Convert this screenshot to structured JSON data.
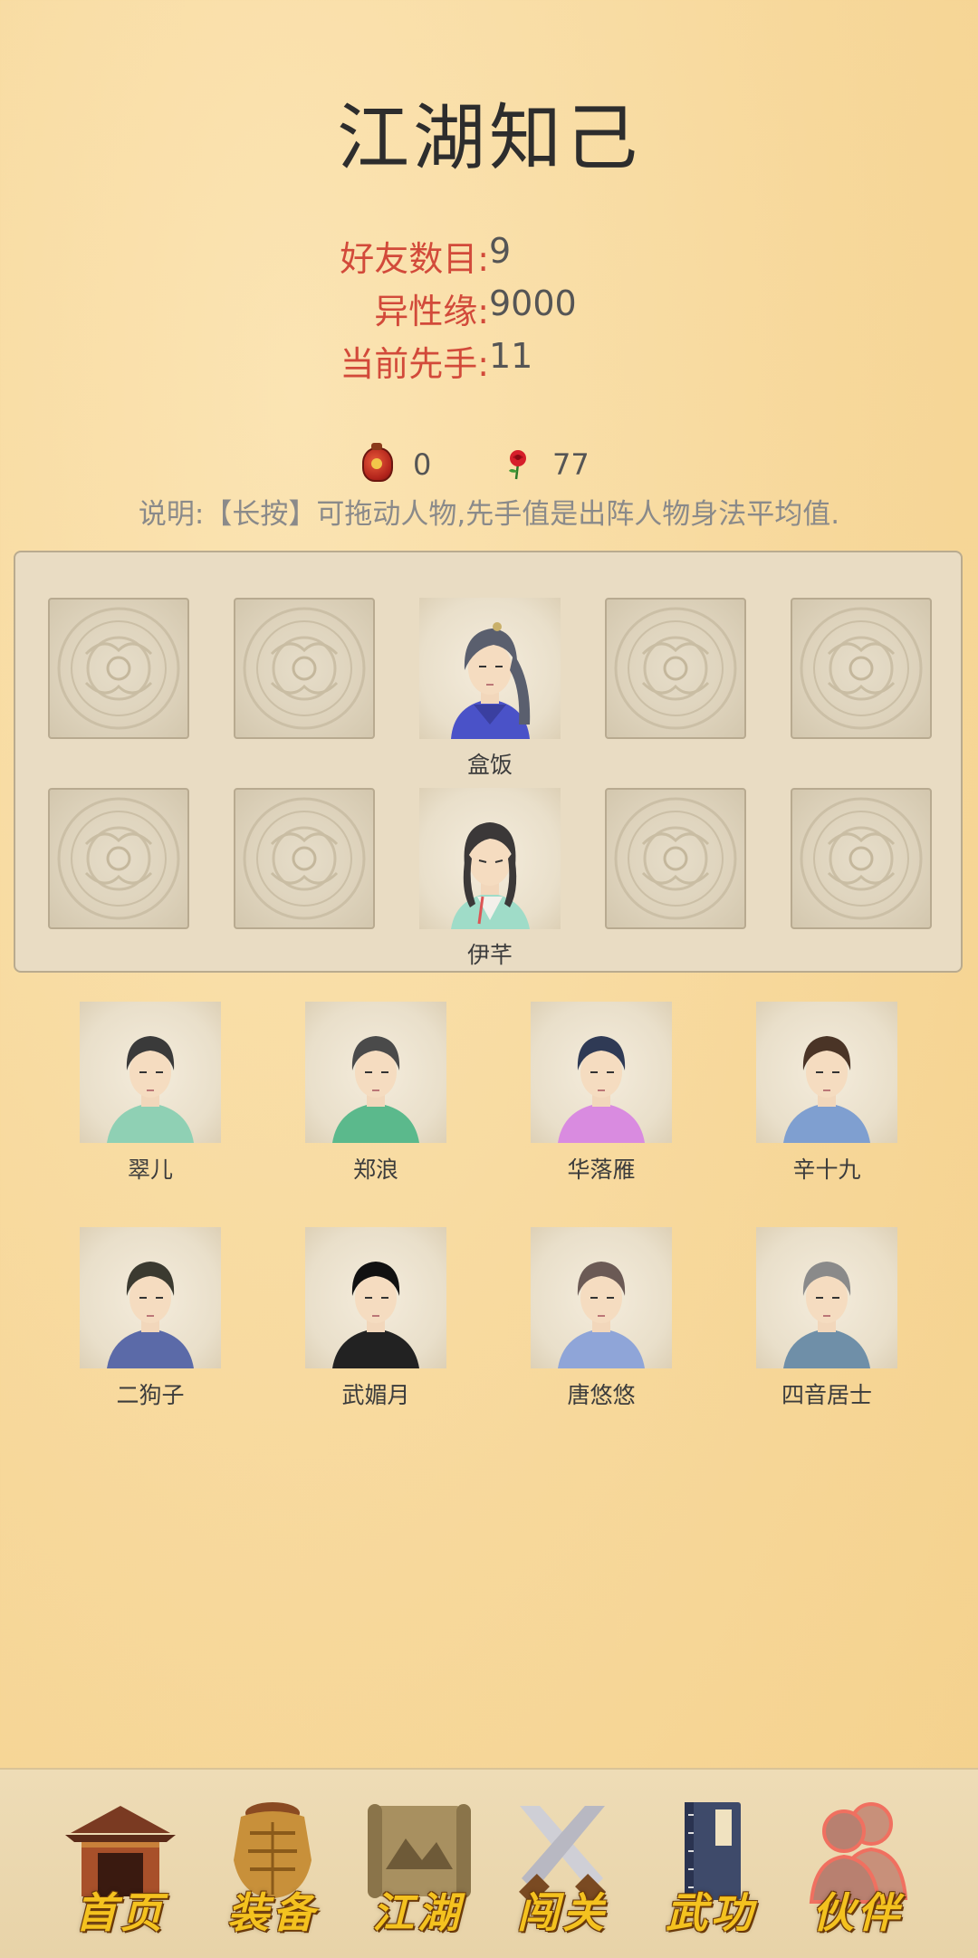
{
  "header": {
    "title": "江湖知己"
  },
  "stats": [
    {
      "label": "好友数目:",
      "value": "9"
    },
    {
      "label": "异性缘:",
      "value": "9000"
    },
    {
      "label": "当前先手:",
      "value": "11"
    }
  ],
  "currency": {
    "jar": {
      "icon": "wine-jar-icon",
      "value": "0"
    },
    "rose": {
      "icon": "rose-icon",
      "value": "77"
    }
  },
  "description": "说明:【长按】可拖动人物,先手值是出阵人物身法平均值.",
  "lineup": {
    "row1": {
      "name": "盒饭"
    },
    "row2": {
      "name": "伊芊"
    }
  },
  "companions": [
    {
      "name": "翠儿",
      "hair": "#3a3a3a",
      "robe": "#8fd0b4"
    },
    {
      "name": "郑浪",
      "hair": "#4a4a4a",
      "robe": "#5bb98c"
    },
    {
      "name": "华落雁",
      "hair": "#2f3a55",
      "robe": "#d98be0"
    },
    {
      "name": "辛十九",
      "hair": "#4a3426",
      "robe": "#7f9fd0"
    },
    {
      "name": "二狗子",
      "hair": "#3b3a30",
      "robe": "#5b6aa8"
    },
    {
      "name": "武媚月",
      "hair": "#111111",
      "robe": "#222222"
    },
    {
      "name": "唐悠悠",
      "hair": "#6b5a55",
      "robe": "#8fa5d8"
    },
    {
      "name": "四音居士",
      "hair": "#8a8a8a",
      "robe": "#6f8fa8"
    }
  ],
  "nav": [
    {
      "label": "首页",
      "icon": "pavilion-icon"
    },
    {
      "label": "装备",
      "icon": "armor-icon"
    },
    {
      "label": "江湖",
      "icon": "scroll-map-icon"
    },
    {
      "label": "闯关",
      "icon": "crossed-swords-icon"
    },
    {
      "label": "武功",
      "icon": "martial-book-icon"
    },
    {
      "label": "伙伴",
      "icon": "companions-icon"
    }
  ]
}
